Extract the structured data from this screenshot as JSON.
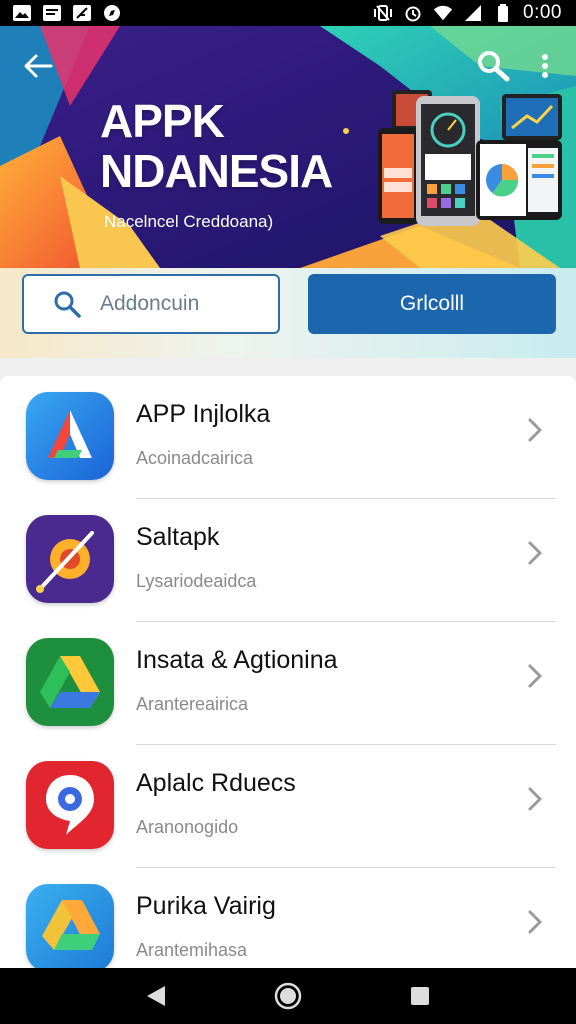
{
  "status_bar": {
    "time": "0:00",
    "left_icons": [
      "gallery-icon",
      "message-icon",
      "feather-icon",
      "compass-icon"
    ],
    "right_icons": [
      "vibrate-icon",
      "alarm-icon",
      "wifi-icon",
      "signal-icon",
      "battery-icon"
    ]
  },
  "hero": {
    "title_line1": "APPK",
    "title_line2": "NDANESIA",
    "subtitle": "Nacelncel Creddoana)",
    "icons": {
      "back": "arrow-left-icon",
      "search": "search-icon",
      "more": "more-vertical-icon"
    }
  },
  "actions": {
    "search_text": "Addoncuin",
    "download_label": "Grlcolll"
  },
  "apps": [
    {
      "name": "APP Injlolka",
      "desc": "Acoinadcairica",
      "icon": "app-logo-a-icon"
    },
    {
      "name": "Saltapk",
      "desc": "Lysariodeaidca",
      "icon": "app-logo-needle-icon"
    },
    {
      "name": "Insata & Agtionina",
      "desc": "Arantereairica",
      "icon": "app-logo-drive-icon"
    },
    {
      "name": "Aplalc Rduecs",
      "desc": "Aranonogido",
      "icon": "app-logo-pin-icon"
    },
    {
      "name": "Purika Vairig",
      "desc": "Arantemihasa",
      "icon": "app-logo-triangle-icon"
    }
  ],
  "colors": {
    "primary": "#1b66ad",
    "hero_bg": "#2a1c78",
    "accent_teal": "#1fb3a8",
    "accent_orange": "#f47a2a"
  },
  "nav_bar": {
    "buttons": [
      "back-triangle-icon",
      "home-circle-icon",
      "recents-square-icon"
    ]
  }
}
